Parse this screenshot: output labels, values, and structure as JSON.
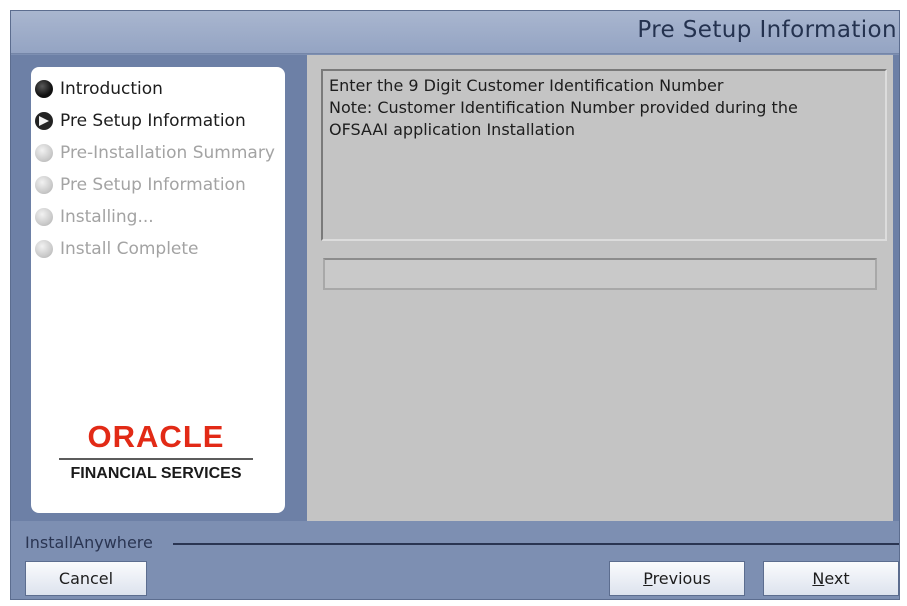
{
  "window": {
    "title": "Pre Setup Information"
  },
  "sidebar": {
    "steps": [
      {
        "label": "Introduction",
        "state": "done"
      },
      {
        "label": "Pre Setup Information",
        "state": "current"
      },
      {
        "label": "Pre-Installation Summary",
        "state": "pending"
      },
      {
        "label": "Pre Setup Information",
        "state": "pending"
      },
      {
        "label": "Installing...",
        "state": "pending"
      },
      {
        "label": "Install Complete",
        "state": "pending"
      }
    ],
    "logo": {
      "brand": "ORACLE",
      "subtitle": "FINANCIAL SERVICES"
    }
  },
  "content": {
    "message_lines": [
      "Enter the 9 Digit Customer Identification Number",
      "Note: Customer Identification Number provided during the",
      "OFSAAI application Installation"
    ],
    "cid_input": {
      "value": "",
      "placeholder": ""
    }
  },
  "footer": {
    "installer_label": "InstallAnywhere",
    "cancel_label": "Cancel",
    "previous_label": "Previous",
    "next_label": "Next"
  },
  "colors": {
    "chrome": "#7d8fb2",
    "content_bg": "#c4c4c4",
    "oracle_red": "#e22a16"
  }
}
